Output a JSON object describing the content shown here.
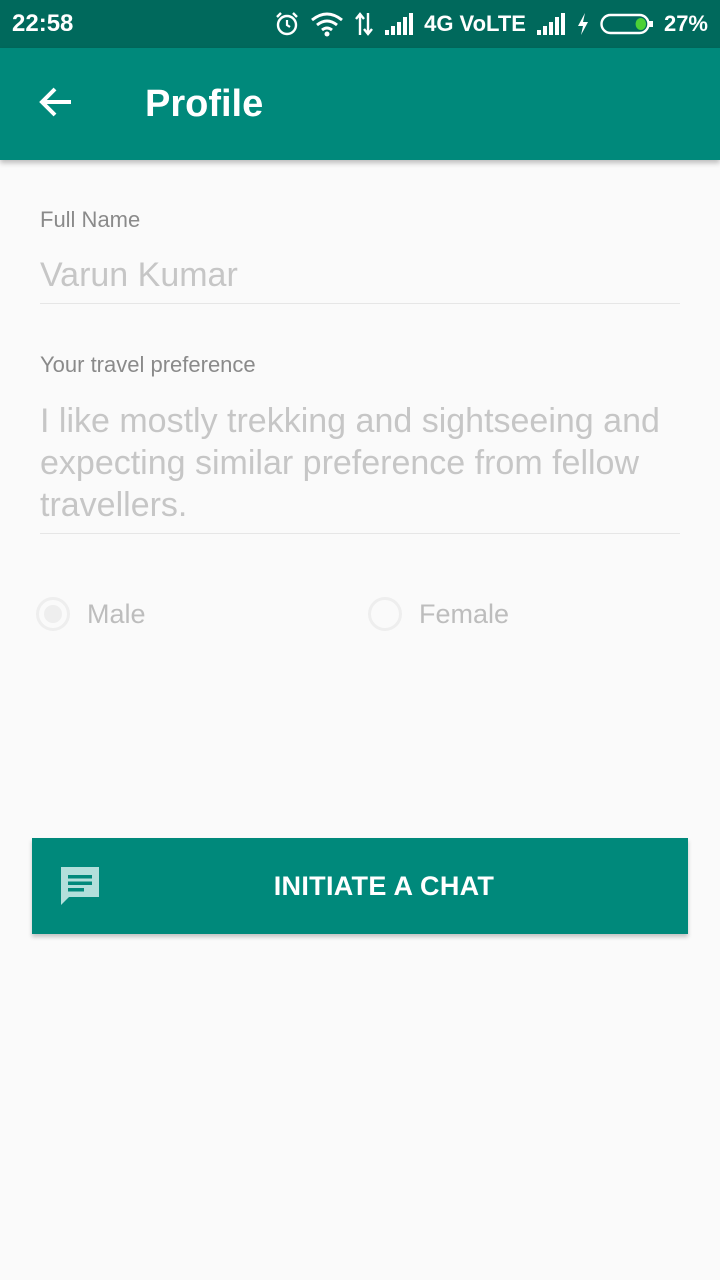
{
  "colors": {
    "status_bar": "#00695c",
    "app_bar": "#00897b",
    "button": "#00897b",
    "background": "#fafafa"
  },
  "status_bar": {
    "time": "22:58",
    "network_label": "4G VoLTE",
    "battery_percent": "27%",
    "battery_level": 0.27,
    "icons": [
      "alarm-icon",
      "wifi-icon",
      "data-arrows-icon",
      "signal-icon",
      "signal-icon",
      "charging-icon",
      "battery-icon"
    ]
  },
  "app_bar": {
    "title": "Profile",
    "back_icon": "arrow-back-icon"
  },
  "form": {
    "full_name": {
      "label": "Full Name",
      "value": "Varun Kumar"
    },
    "travel_preference": {
      "label": "Your travel preference",
      "value": "I like mostly trekking and sightseeing and expecting similar preference from fellow travellers."
    },
    "gender": {
      "options": [
        {
          "label": "Male",
          "selected": true
        },
        {
          "label": "Female",
          "selected": false
        }
      ]
    }
  },
  "chat_button": {
    "label": "INITIATE A CHAT",
    "icon": "chat-message-icon"
  }
}
